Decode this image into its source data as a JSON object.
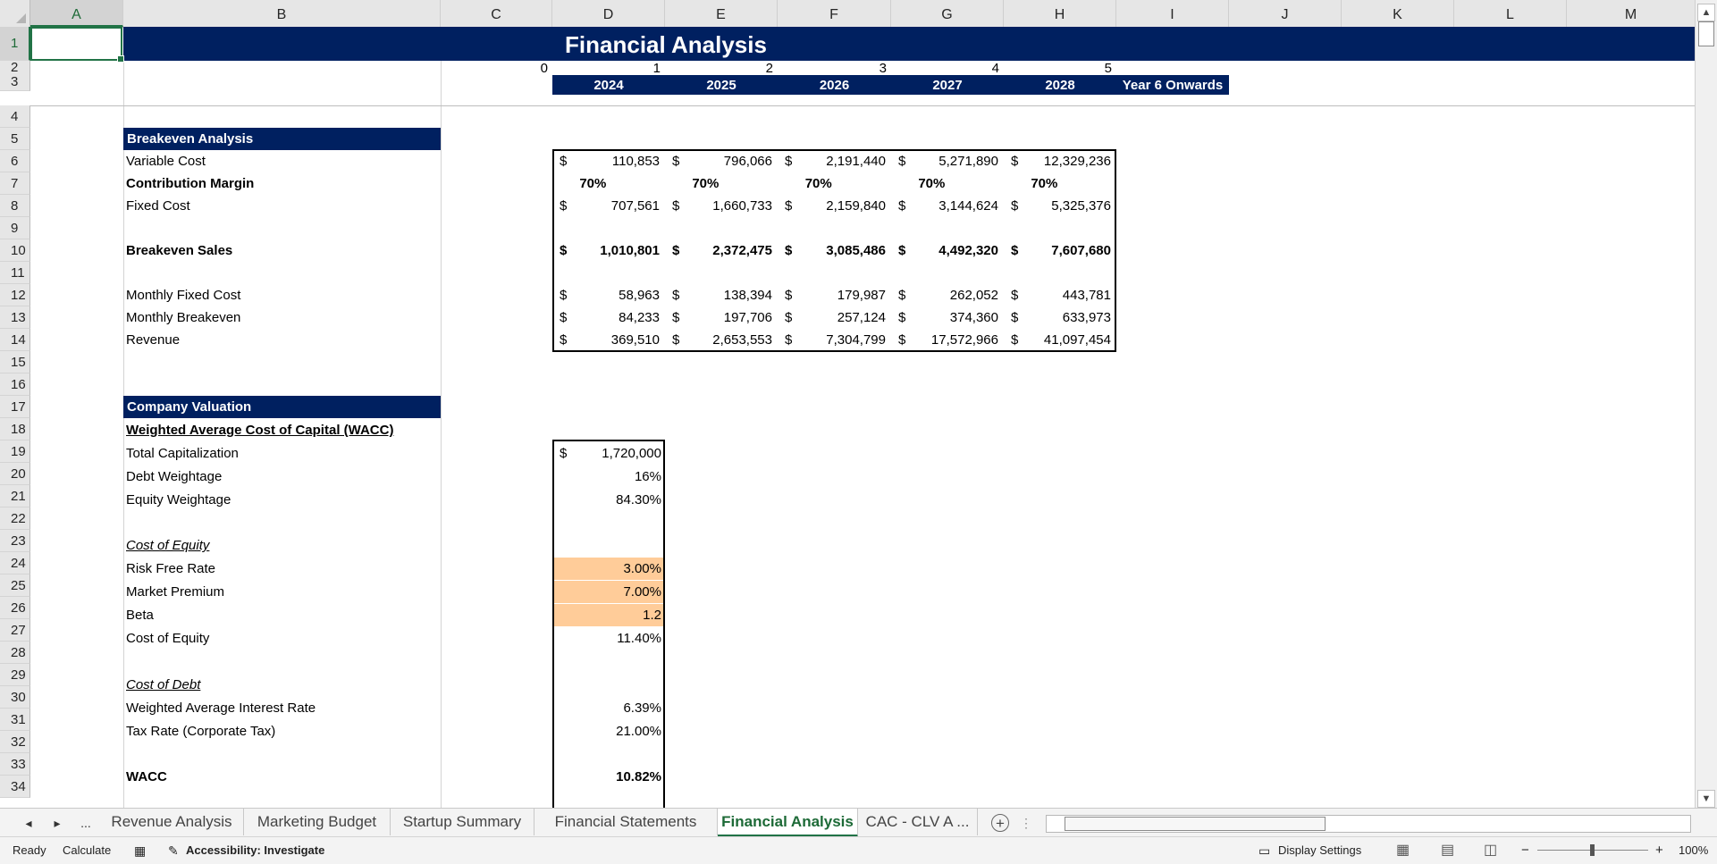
{
  "columns": [
    "A",
    "B",
    "C",
    "D",
    "E",
    "F",
    "G",
    "H",
    "I",
    "J",
    "K",
    "L",
    "M"
  ],
  "rows": [
    "1",
    "2",
    "3",
    "4",
    "5",
    "6",
    "7",
    "8",
    "9",
    "10",
    "11",
    "12",
    "13",
    "14",
    "15",
    "16",
    "17",
    "18",
    "19",
    "20",
    "21",
    "22",
    "23",
    "24",
    "25",
    "26",
    "27",
    "28",
    "29",
    "30",
    "31",
    "32",
    "33",
    "34"
  ],
  "sheet": {
    "title": "Financial Analysis",
    "period_numbers": [
      "0",
      "1",
      "2",
      "3",
      "4",
      "5"
    ],
    "year_labels": [
      "2024",
      "2025",
      "2026",
      "2027",
      "2028",
      "Year 6 Onwards"
    ],
    "breakeven": {
      "header": "Breakeven Analysis",
      "currency": "$",
      "variable_cost": {
        "label": "Variable Cost",
        "values": [
          "110,853",
          "796,066",
          "2,191,440",
          "5,271,890",
          "12,329,236"
        ]
      },
      "contribution_margin": {
        "label": "Contribution Margin",
        "values": [
          "70%",
          "70%",
          "70%",
          "70%",
          "70%"
        ]
      },
      "fixed_cost": {
        "label": "Fixed Cost",
        "values": [
          "707,561",
          "1,660,733",
          "2,159,840",
          "3,144,624",
          "5,325,376"
        ]
      },
      "breakeven_sales": {
        "label": "Breakeven Sales",
        "values": [
          "1,010,801",
          "2,372,475",
          "3,085,486",
          "4,492,320",
          "7,607,680"
        ]
      },
      "monthly_fixed_cost": {
        "label": "Monthly Fixed Cost",
        "values": [
          "58,963",
          "138,394",
          "179,987",
          "262,052",
          "443,781"
        ]
      },
      "monthly_breakeven": {
        "label": "Monthly Breakeven",
        "values": [
          "84,233",
          "197,706",
          "257,124",
          "374,360",
          "633,973"
        ]
      },
      "revenue": {
        "label": "Revenue",
        "values": [
          "369,510",
          "2,653,553",
          "7,304,799",
          "17,572,966",
          "41,097,454"
        ]
      }
    },
    "valuation": {
      "header": "Company Valuation",
      "wacc_header": "Weighted Average Cost of Capital (WACC)",
      "total_cap": {
        "label": "Total Capitalization",
        "currency": "$",
        "value": "1,720,000"
      },
      "debt_weight": {
        "label": "Debt Weightage",
        "value": "16%"
      },
      "equity_weight": {
        "label": "Equity Weightage",
        "value": "84.30%"
      },
      "cost_of_equity_header": "Cost of Equity",
      "risk_free": {
        "label": "Risk Free Rate",
        "value": "3.00%"
      },
      "market_premium": {
        "label": "Market Premium",
        "value": "7.00%"
      },
      "beta": {
        "label": "Beta",
        "value": "1.2"
      },
      "cost_of_equity": {
        "label": "Cost of Equity",
        "value": "11.40%"
      },
      "cost_of_debt_header": "Cost of Debt",
      "interest_rate": {
        "label": "Weighted Average Interest Rate",
        "value": "6.39%"
      },
      "tax_rate": {
        "label": "Tax Rate (Corporate Tax)",
        "value": "21.00%"
      },
      "wacc": {
        "label": "WACC",
        "value": "10.82%"
      }
    }
  },
  "tabs": {
    "prev": "◂",
    "next": "▸",
    "more": "...",
    "items": [
      "Revenue Analysis",
      "Marketing Budget",
      "Startup Summary",
      "Financial Statements",
      "Financial Analysis",
      "CAC - CLV A ..."
    ],
    "active": "Financial Analysis",
    "add": "+",
    "options": "⋮"
  },
  "status": {
    "ready": "Ready",
    "calculate": "Calculate",
    "accessibility": "Accessibility: Investigate",
    "display_settings": "Display Settings",
    "zoom": "100%",
    "zoom_minus": "−",
    "zoom_plus": "+"
  },
  "colors": {
    "navy": "#002060",
    "input_fill": "#ffcc99",
    "excel_green": "#217346"
  }
}
